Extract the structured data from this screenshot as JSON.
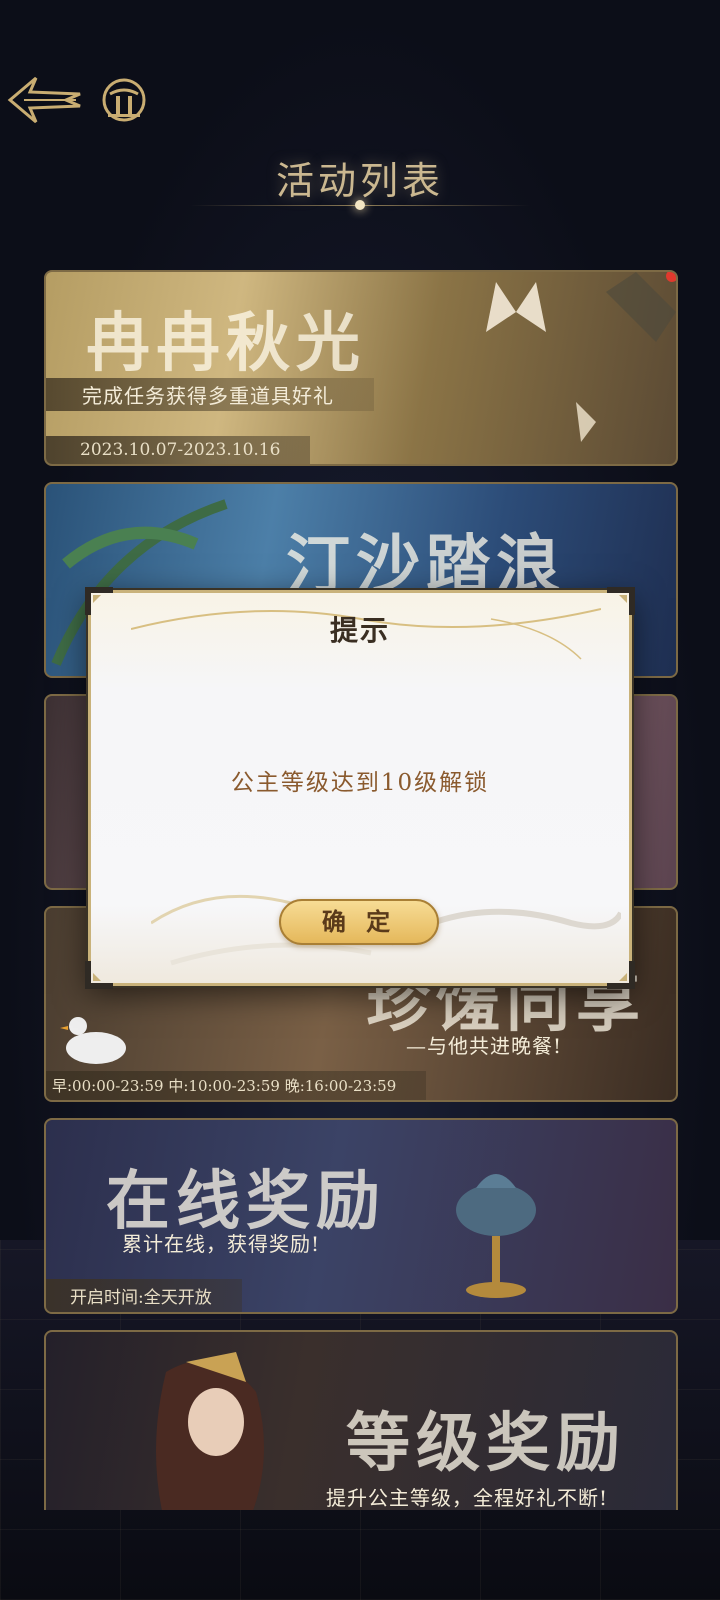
{
  "header": {
    "title": "活动列表"
  },
  "activities": [
    {
      "title": "冉冉秋光",
      "subtitle": "完成任务获得多重道具好礼",
      "date": "2023.10.07-2023.10.16",
      "has_red_dot": true
    },
    {
      "title": "汀沙踏浪",
      "subtitle": "",
      "date": "",
      "has_red_dot": false
    },
    {
      "title": "",
      "subtitle": "",
      "date": "",
      "has_red_dot": false
    },
    {
      "title": "珍馐同享",
      "subtitle": "—与他共进晚餐!",
      "date": "早:00:00-23:59 中:10:00-23:59 晚:16:00-23:59",
      "has_red_dot": false
    },
    {
      "title": "在线奖励",
      "subtitle": "累计在线，获得奖励!",
      "date": "开启时间:全天开放",
      "has_red_dot": false
    },
    {
      "title": "等级奖励",
      "subtitle": "提升公主等级，全程好礼不断!",
      "date": "",
      "has_red_dot": false
    }
  ],
  "dialog": {
    "title": "提示",
    "message": "公主等级达到10级解锁",
    "confirm_label": "确 定"
  },
  "colors": {
    "accent_gold": "#cbb890",
    "dialog_border": "#c9b27a",
    "button_gold": "#e5b85b",
    "red_dot": "#e0392d"
  }
}
